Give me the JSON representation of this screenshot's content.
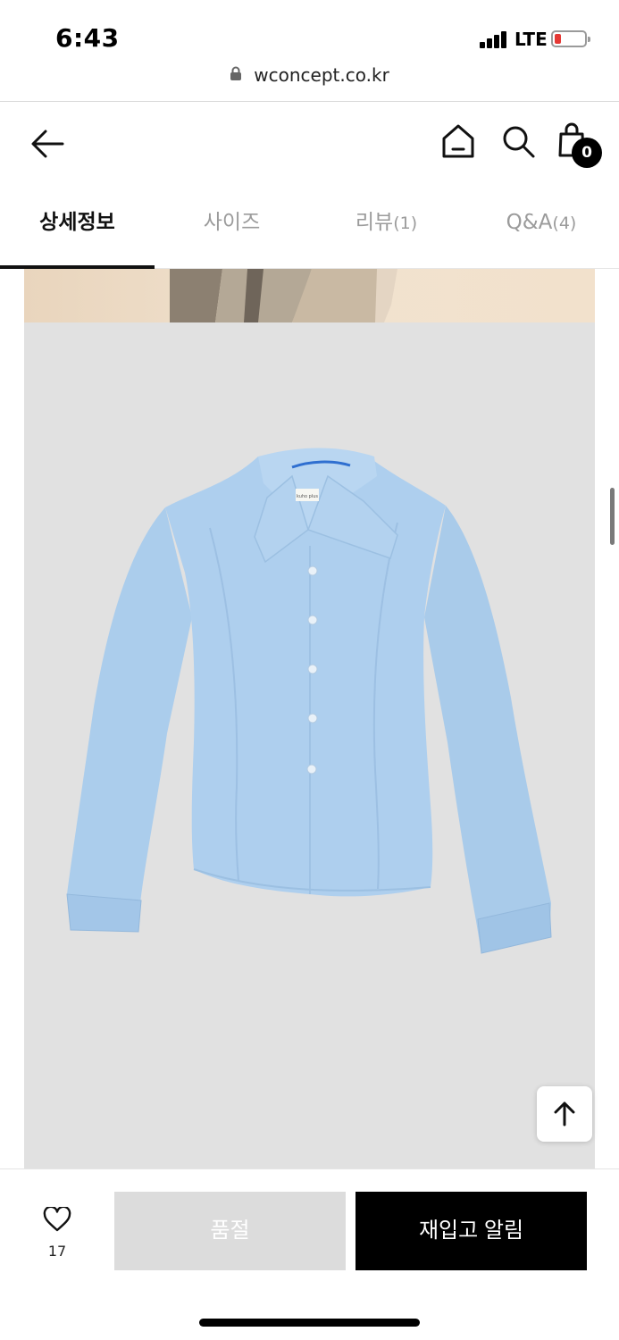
{
  "status_bar": {
    "time": "6:43",
    "network": "LTE"
  },
  "browser": {
    "url": "wconcept.co.kr"
  },
  "header": {
    "cart_count": "0",
    "icons": [
      "back-arrow-icon",
      "home-icon",
      "search-icon",
      "shopping-bag-icon"
    ]
  },
  "tabs": [
    {
      "label": "상세정보",
      "count": "",
      "active": true
    },
    {
      "label": "사이즈",
      "count": "",
      "active": false
    },
    {
      "label": "리뷰",
      "count": "(1)",
      "active": false
    },
    {
      "label": "Q&A",
      "count": "(4)",
      "active": false
    }
  ],
  "product_image": {
    "label_text": "kuho plus",
    "colors": {
      "shirt": "#aecfee",
      "background": "#e1e1e1"
    }
  },
  "bottom_bar": {
    "like_count": "17",
    "soldout_label": "품절",
    "restock_label": "재입고 알림"
  },
  "colors": {
    "accent": "#000000",
    "disabled_button": "#dcdcdc",
    "inactive_tab": "#9b9b9b"
  }
}
